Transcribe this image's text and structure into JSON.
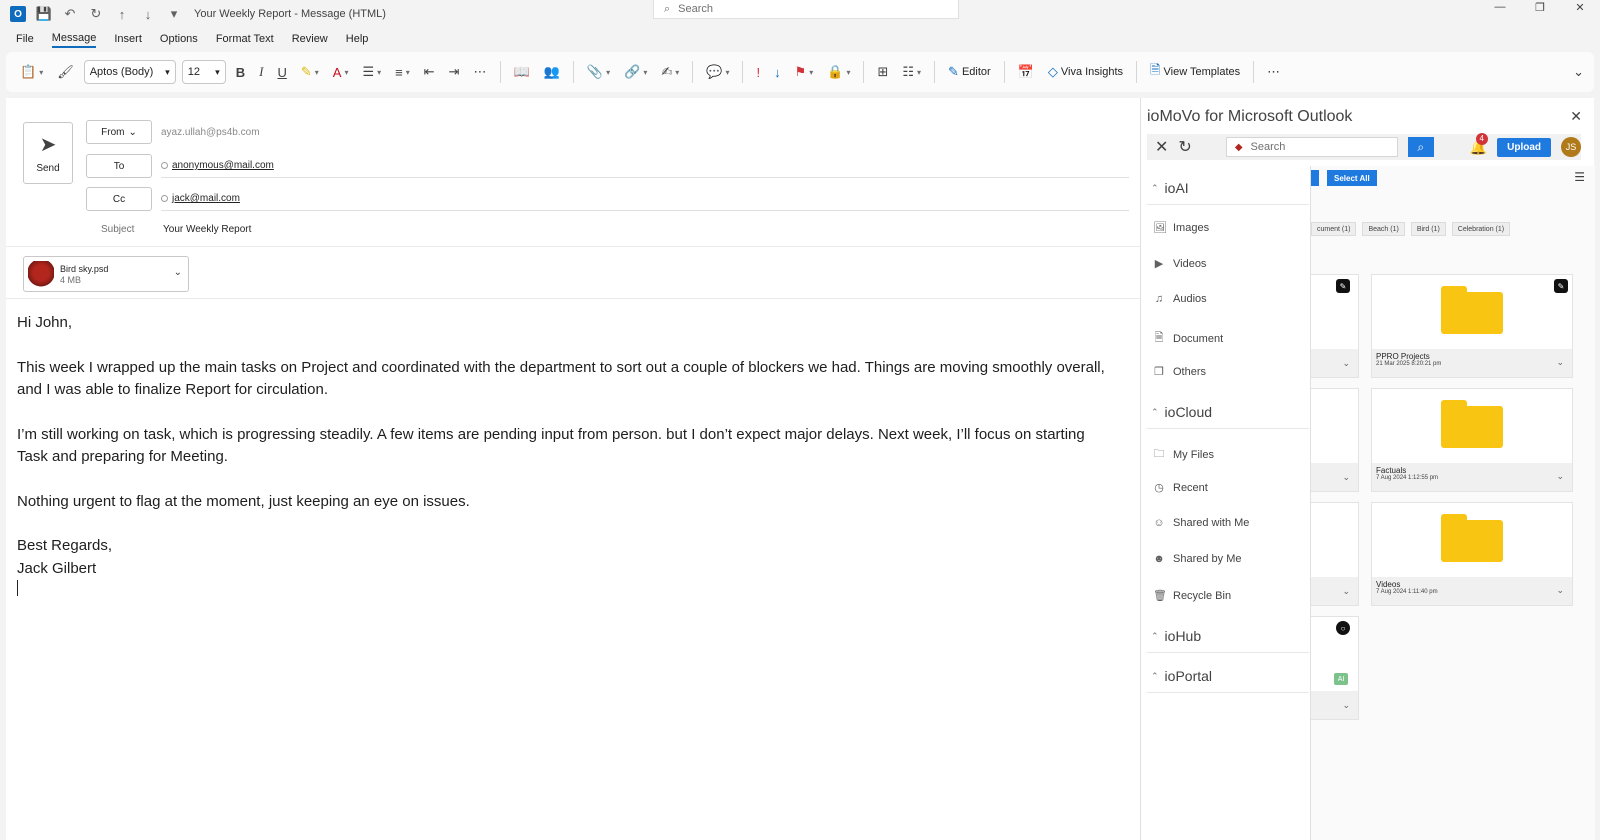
{
  "window": {
    "title": "Your Weekly Report  -  Message (HTML)",
    "search_placeholder": "Search"
  },
  "menu": [
    "File",
    "Message",
    "Insert",
    "Options",
    "Format Text",
    "Review",
    "Help"
  ],
  "ribbon": {
    "font": "Aptos (Body)",
    "size": "12",
    "editor": "Editor",
    "viva": "Viva Insights",
    "templates": "View Templates"
  },
  "compose": {
    "send": "Send",
    "from_label": "From",
    "from_value": "ayaz.ullah@ps4b.com",
    "to_label": "To",
    "to_value": "anonymous@mail.com",
    "cc_label": "Cc",
    "cc_value": "jack@mail.com",
    "subject_label": "Subject",
    "subject_value": "Your Weekly Report",
    "attachment": {
      "name": "Bird sky.psd",
      "size": "4 MB"
    },
    "body": {
      "greeting": "Hi John,",
      "p1": "This week I wrapped up the main tasks on Project and coordinated with the department to sort out a couple of blockers we had. Things are moving smoothly overall, and I was able to finalize Report for circulation.",
      "p2": "I’m still working on task, which is progressing steadily. A few items are pending input from person. but I don’t expect major delays. Next week, I’ll focus on starting Task and preparing for Meeting.",
      "p3": "Nothing urgent to flag at the moment, just keeping an eye on issues.",
      "closing": "Best Regards,",
      "signature": "Jack Gilbert"
    }
  },
  "panel": {
    "title": "ioMoVo for Microsoft Outlook",
    "search_placeholder": "Search",
    "notifications": "4",
    "upload": "Upload",
    "avatar": "JS",
    "select_all": "Select All",
    "sections": {
      "ioai": "ioAI",
      "iocloud": "ioCloud",
      "iohub": "ioHub",
      "ioportal": "ioPortal"
    },
    "ioai_items": [
      "Images",
      "Videos",
      "Audios",
      "Document",
      "Others"
    ],
    "iocloud_items": [
      "My Files",
      "Recent",
      "Shared with Me",
      "Shared by Me",
      "Recycle Bin"
    ],
    "chips": [
      "cument (1)",
      "Beach (1)",
      "Bird (1)",
      "Celebration (1)"
    ],
    "cards": [
      {
        "name": "PPRO Projects",
        "date": "21 Mar 2025 8:20:21 pm"
      },
      {
        "name": "Factuals",
        "date": "7 Aug 2024 1:12:55 pm"
      },
      {
        "name": "Videos",
        "date": "7 Aug 2024 1:11:40 pm"
      }
    ],
    "ai_badge": "AI"
  }
}
